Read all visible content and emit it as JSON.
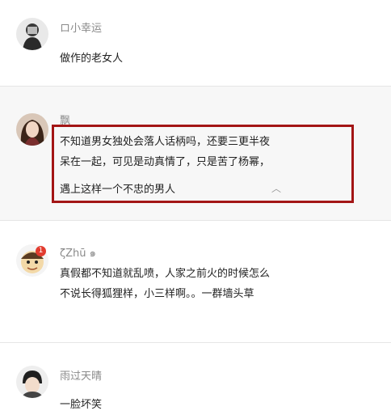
{
  "comments": [
    {
      "username": "ロ小幸运",
      "lines": [
        "做作的老女人"
      ]
    },
    {
      "username": "飘",
      "lines": [
        "不知道男女独处会落人话柄吗，还要三更半夜",
        "呆在一起，可见是动真情了，只是苦了杨幂，",
        "遇上这样一个不忠的男人"
      ],
      "collapse_icon": "chevron-up-icon",
      "collapse_glyph": "︿"
    },
    {
      "username": "ζZhū ๑",
      "lines": [
        "真假都不知道就乱喷，人家之前火的时候怎么",
        "不说长得狐狸样，小三样啊。。一群墙头草"
      ],
      "badge": "1"
    },
    {
      "username": "雨过天晴",
      "lines": [
        "一脸坏笑"
      ]
    }
  ],
  "colors": {
    "highlight_border": "#a31515",
    "username": "#8a8a8a",
    "text": "#222222",
    "highlighted_bg": "#f7f7f7",
    "badge": "#e23b2e"
  }
}
